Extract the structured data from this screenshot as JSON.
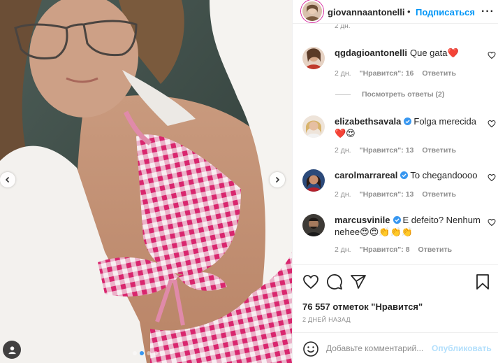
{
  "post": {
    "username": "giovannaantonelli",
    "separator": "•",
    "follow_label": "Подписаться",
    "more_label": "···",
    "truncated_time": "2 дн.",
    "carousel_total": 4,
    "carousel_active": 2
  },
  "comments": [
    {
      "username": "qgdagioantonelli",
      "verified": false,
      "text": "Que gata❤️",
      "time": "2 дн.",
      "likes": "\"Нравится\": 16",
      "reply_label": "Ответить",
      "view_replies": "Посмотреть ответы (2)"
    },
    {
      "username": "elizabethsavala",
      "verified": true,
      "text": "Folga merecida ❤️😍",
      "time": "2 дн.",
      "likes": "\"Нравится\": 13",
      "reply_label": "Ответить"
    },
    {
      "username": "carolmarrareal",
      "verified": true,
      "text": "To chegandoooo",
      "time": "2 дн.",
      "likes": "\"Нравится\": 13",
      "reply_label": "Ответить"
    },
    {
      "username": "marcusvinile",
      "verified": true,
      "text": "E defeito? Nenhum nehee😍😍👏👏👏",
      "time": "2 дн.",
      "likes": "\"Нравится\": 8",
      "reply_label": "Ответить"
    }
  ],
  "stats": {
    "likes_text": "76 557 отметок \"Нравится\"",
    "date_text": "2 ДНЕЙ НАЗАД"
  },
  "composer": {
    "placeholder": "Добавьте комментарий...",
    "publish_label": "Опубликовать"
  },
  "icons": {
    "like": "heart-icon",
    "comment": "comment-icon",
    "share": "share-icon",
    "save": "bookmark-icon",
    "emoji": "emoji-icon",
    "tag": "user-tag-icon",
    "prev": "chevron-left-icon",
    "next": "chevron-right-icon"
  },
  "colors": {
    "accent": "#0095f6",
    "verified": "#3897f0",
    "muted": "#8e8e8e",
    "heart_red": "#ed4956"
  }
}
